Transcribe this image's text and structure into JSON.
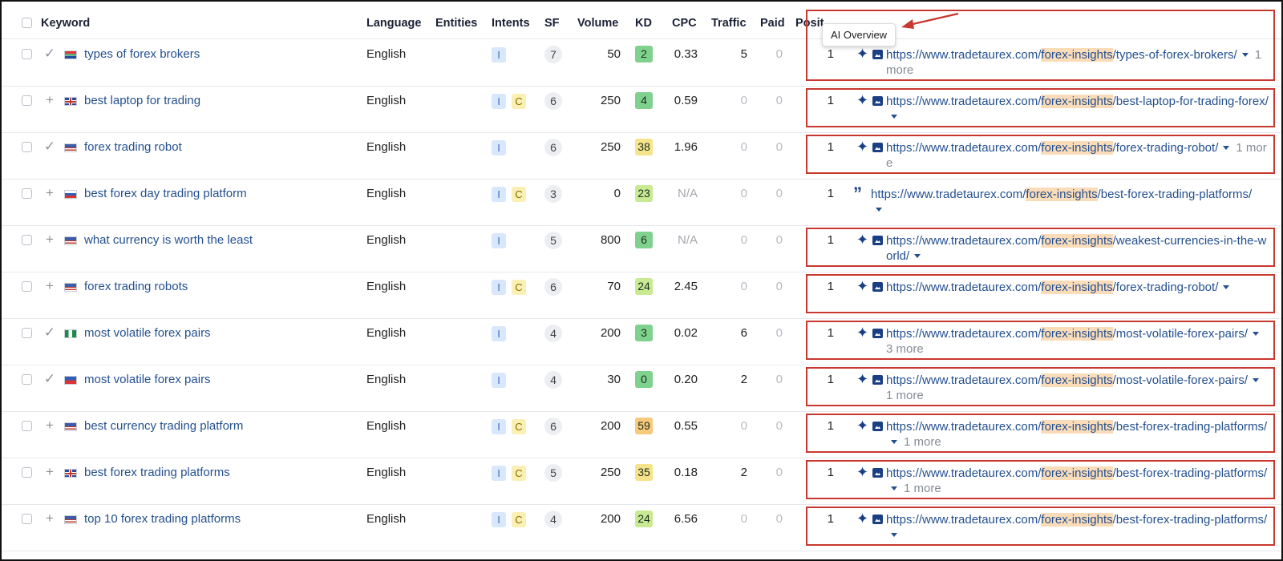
{
  "header": {
    "keyword": "Keyword",
    "language": "Language",
    "entities": "Entities",
    "intents": "Intents",
    "sf": "SF",
    "volume": "Volume",
    "kd": "KD",
    "cpc": "CPC",
    "traffic": "Traffic",
    "paid": "Paid",
    "position": "Positi"
  },
  "tooltip": "AI Overview",
  "url_parts": {
    "prefix": "https://www.tradetaurex.com/",
    "highlight": "forex-insights",
    "slash": "/"
  },
  "rows": [
    {
      "mark": "check",
      "flag": "za",
      "keyword": "types of forex brokers",
      "language": "English",
      "intents": [
        "I"
      ],
      "sf": "7",
      "volume": "50",
      "kd": "2",
      "cpc": "0.33",
      "traffic": "5",
      "paid": "0",
      "pos": "1",
      "ai": true,
      "url_rest": "types-of-forex-brokers/",
      "more": "1 more"
    },
    {
      "mark": "plus",
      "flag": "gb",
      "keyword": "best laptop for trading",
      "language": "English",
      "intents": [
        "I",
        "C"
      ],
      "sf": "6",
      "volume": "250",
      "kd": "4",
      "cpc": "0.59",
      "traffic": "0",
      "paid": "0",
      "pos": "1",
      "ai": true,
      "url_rest": "best-laptop-for-trading-forex/",
      "more": ""
    },
    {
      "mark": "check",
      "flag": "us",
      "keyword": "forex trading robot",
      "language": "English",
      "intents": [
        "I"
      ],
      "sf": "6",
      "volume": "250",
      "kd": "38",
      "cpc": "1.96",
      "traffic": "0",
      "paid": "0",
      "pos": "1",
      "ai": true,
      "url_rest": "forex-trading-robot/",
      "more": "1 more"
    },
    {
      "mark": "plus",
      "flag": "ru",
      "keyword": "best forex day trading platform",
      "language": "English",
      "intents": [
        "I",
        "C"
      ],
      "sf": "3",
      "volume": "0",
      "kd": "23",
      "cpc": "N/A",
      "traffic": "0",
      "paid": "0",
      "pos": "1",
      "ai": false,
      "url_rest": "best-forex-trading-platforms/",
      "more": ""
    },
    {
      "mark": "plus",
      "flag": "us",
      "keyword": "what currency is worth the least",
      "language": "English",
      "intents": [
        "I"
      ],
      "sf": "5",
      "volume": "800",
      "kd": "6",
      "cpc": "N/A",
      "traffic": "0",
      "paid": "0",
      "pos": "1",
      "ai": true,
      "url_rest": "weakest-currencies-in-the-world/",
      "more": ""
    },
    {
      "mark": "plus",
      "flag": "us",
      "keyword": "forex trading robots",
      "language": "English",
      "intents": [
        "I",
        "C"
      ],
      "sf": "6",
      "volume": "70",
      "kd": "24",
      "cpc": "2.45",
      "traffic": "0",
      "paid": "0",
      "pos": "1",
      "ai": true,
      "url_rest": "forex-trading-robot/",
      "more": ""
    },
    {
      "mark": "check",
      "flag": "ng",
      "keyword": "most volatile forex pairs",
      "language": "English",
      "intents": [
        "I"
      ],
      "sf": "4",
      "volume": "200",
      "kd": "3",
      "cpc": "0.02",
      "traffic": "6",
      "paid": "0",
      "pos": "1",
      "ai": true,
      "url_rest": "most-volatile-forex-pairs/",
      "more": "3 more"
    },
    {
      "mark": "check",
      "flag": "ph",
      "keyword": "most volatile forex pairs",
      "language": "English",
      "intents": [
        "I"
      ],
      "sf": "4",
      "volume": "30",
      "kd": "0",
      "cpc": "0.20",
      "traffic": "2",
      "paid": "0",
      "pos": "1",
      "ai": true,
      "url_rest": "most-volatile-forex-pairs/",
      "more": "1 more"
    },
    {
      "mark": "plus",
      "flag": "us",
      "keyword": "best currency trading platform",
      "language": "English",
      "intents": [
        "I",
        "C"
      ],
      "sf": "6",
      "volume": "200",
      "kd": "59",
      "cpc": "0.55",
      "traffic": "0",
      "paid": "0",
      "pos": "1",
      "ai": true,
      "url_rest": "best-forex-trading-platforms/",
      "more": "1 more"
    },
    {
      "mark": "plus",
      "flag": "gb",
      "keyword": "best forex trading platforms",
      "language": "English",
      "intents": [
        "I",
        "C"
      ],
      "sf": "5",
      "volume": "250",
      "kd": "35",
      "cpc": "0.18",
      "traffic": "2",
      "paid": "0",
      "pos": "1",
      "ai": true,
      "url_rest": "best-forex-trading-platforms/",
      "more": "1 more"
    },
    {
      "mark": "plus",
      "flag": "us",
      "keyword": "top 10 forex trading platforms",
      "language": "English",
      "intents": [
        "I",
        "C"
      ],
      "sf": "4",
      "volume": "200",
      "kd": "24",
      "cpc": "6.56",
      "traffic": "0",
      "paid": "0",
      "pos": "1",
      "ai": true,
      "url_rest": "best-forex-trading-platforms/",
      "more": ""
    }
  ]
}
